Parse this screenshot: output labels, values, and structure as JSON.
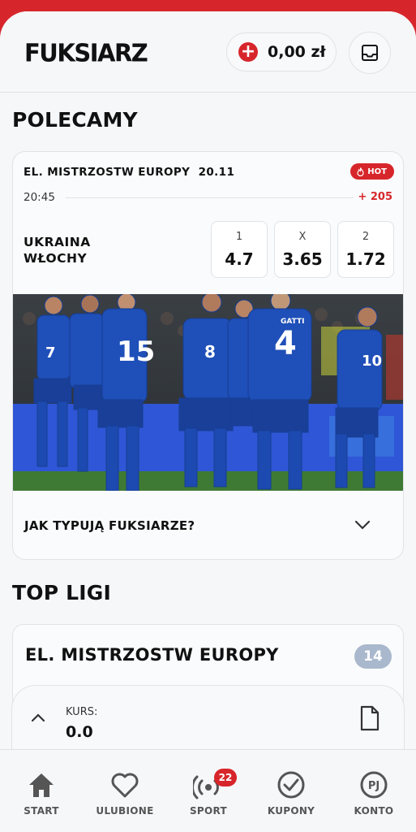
{
  "header": {
    "logo": "FUKSIARZ",
    "balance": "0,00 zł"
  },
  "recommended": {
    "title": "POLECAMY",
    "match": {
      "league": "EL. MISTRZOSTW EUROPY",
      "date": "20.11",
      "hot_label": "HOT",
      "time": "20:45",
      "more_markets": "+ 205",
      "home_team": "UKRAINA",
      "away_team": "WŁOCHY",
      "odds": [
        {
          "label": "1",
          "value": "4.7"
        },
        {
          "label": "X",
          "value": "3.65"
        },
        {
          "label": "2",
          "value": "1.72"
        }
      ],
      "image_alt": "Italian national team players celebrating",
      "predictions_label": "JAK TYPUJĄ FUKSIARZE?"
    }
  },
  "top_leagues": {
    "title": "TOP LIGI",
    "items": [
      {
        "name": "EL. MISTRZOSTW EUROPY",
        "count": "14"
      }
    ]
  },
  "coupon": {
    "kurs_label": "KURS:",
    "kurs_value": "0.0"
  },
  "bottom_nav": {
    "items": [
      {
        "label": "START",
        "icon": "home-icon"
      },
      {
        "label": "ULUBIONE",
        "icon": "heart-icon"
      },
      {
        "label": "SPORT",
        "icon": "sport-live-icon",
        "badge": "22"
      },
      {
        "label": "KUPONY",
        "icon": "check-circle-icon"
      },
      {
        "label": "KONTO",
        "icon": "account-pj-icon",
        "initials": "PJ"
      }
    ]
  },
  "colors": {
    "brand_red": "#d7262b",
    "badge_grey": "#a9b8cc",
    "italy_blue": "#1f4fb8"
  }
}
